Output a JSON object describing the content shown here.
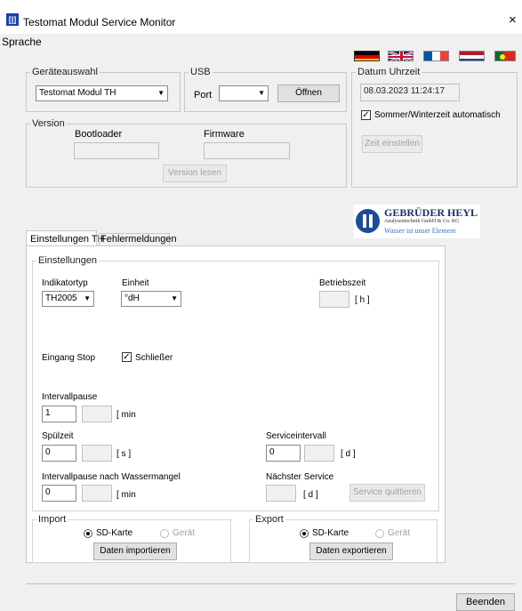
{
  "window": {
    "title": "Testomat Modul Service Monitor",
    "close": "×",
    "app_icon": "[|]"
  },
  "menu": {
    "sprache": "Sprache"
  },
  "flags": [
    "germany-flag",
    "uk-flag",
    "france-flag",
    "netherlands-flag",
    "portugal-flag"
  ],
  "geraeteauswahl": {
    "legend": "Geräteauswahl",
    "value": "Testomat Modul TH"
  },
  "usb": {
    "legend": "USB",
    "port_label": "Port",
    "port_value": "",
    "open_button": "Öffnen"
  },
  "datum": {
    "legend": "Datum Uhrzeit",
    "value": "08.03.2023  11:24:17",
    "dst_label": "Sommer/Winterzeit automatisch",
    "dst_checked": true,
    "set_button": "Zeit einstellen"
  },
  "version": {
    "legend": "Version",
    "bootloader_label": "Bootloader",
    "firmware_label": "Firmware",
    "bootloader_value": "",
    "firmware_value": "",
    "read_button": "Version lesen"
  },
  "logo": {
    "name": "GEBRÜDER HEYL",
    "sub": "Analysentechnik GmbH & Co. KG",
    "tagline": "Wasser ist unser Element"
  },
  "tabs": [
    {
      "label": "Einstellungen TH",
      "active": true
    },
    {
      "label": "Fehlermeldungen",
      "active": false
    }
  ],
  "settings": {
    "legend": "Einstellungen",
    "indikatortyp_label": "Indikatortyp",
    "indikatortyp_value": "TH2005",
    "einheit_label": "Einheit",
    "einheit_value": "°dH",
    "betriebszeit_label": "Betriebszeit",
    "betriebszeit_unit": "[ h ]",
    "eingang_stop_label": "Eingang Stop",
    "schliesser_label": "Schließer",
    "schliesser_checked": true,
    "intervallpause_label": "Intervallpause",
    "intervallpause_value": "1",
    "intervallpause_unit": "[ min",
    "spuelzeit_label": "Spülzeit",
    "spuelzeit_value": "0",
    "spuelzeit_unit": "[ s ]",
    "serviceintervall_label": "Serviceintervall",
    "serviceintervall_value": "0",
    "serviceintervall_unit": "[ d ]",
    "intervallpause_wm_label": "Intervallpause nach Wassermangel",
    "intervallpause_wm_value": "0",
    "intervallpause_wm_unit": "[ min",
    "naechster_service_label": "Nächster Service",
    "naechster_service_unit": "[ d ]",
    "service_quittieren": "Service quittieren"
  },
  "import": {
    "legend": "Import",
    "sd_label": "SD-Karte",
    "geraet_label": "Gerät",
    "button": "Daten importieren"
  },
  "export": {
    "legend": "Export",
    "sd_label": "SD-Karte",
    "geraet_label": "Gerät",
    "button": "Daten exportieren"
  },
  "footer": {
    "beenden": "Beenden"
  }
}
